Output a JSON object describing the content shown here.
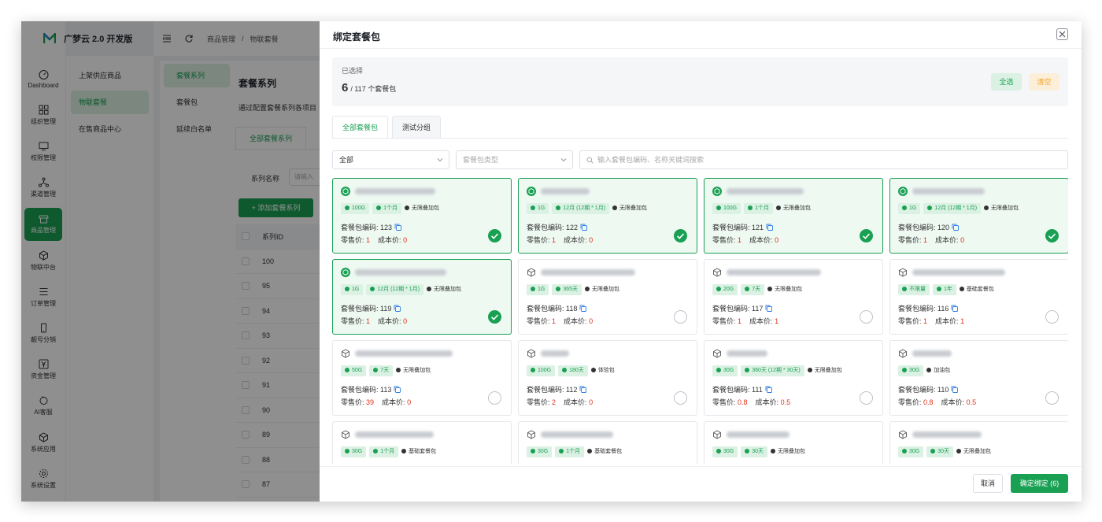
{
  "app": {
    "title": "广梦云 2.0 开发版"
  },
  "nav": [
    {
      "label": "Dashboard",
      "icon": "dashboard-icon",
      "active": false
    },
    {
      "label": "组织管理",
      "icon": "grid-icon",
      "active": false
    },
    {
      "label": "权限管理",
      "icon": "monitor-icon",
      "active": false
    },
    {
      "label": "渠道管理",
      "icon": "network-icon",
      "active": false
    },
    {
      "label": "商品管理",
      "icon": "store-icon",
      "active": true
    },
    {
      "label": "物联中台",
      "icon": "cube-icon",
      "active": false
    },
    {
      "label": "订单管理",
      "icon": "list-icon",
      "active": false
    },
    {
      "label": "靓号分销",
      "icon": "phone-icon",
      "active": false
    },
    {
      "label": "资金管理",
      "icon": "yuan-icon",
      "active": false
    },
    {
      "label": "AI客服",
      "icon": "bot-icon",
      "active": false
    },
    {
      "label": "系统应用",
      "icon": "box-icon",
      "active": false
    },
    {
      "label": "系统设置",
      "icon": "gear-icon",
      "active": false
    }
  ],
  "subnav": [
    {
      "label": "上架供应商品",
      "active": false
    },
    {
      "label": "物联套餐",
      "active": true
    },
    {
      "label": "在售商品中心",
      "active": false
    }
  ],
  "breadcrumb": {
    "parent": "商品管理",
    "sep": "/",
    "current": "物联套餐"
  },
  "series_menu": [
    {
      "label": "套餐系列",
      "active": true
    },
    {
      "label": "套餐包",
      "active": false
    },
    {
      "label": "延续白名单",
      "active": false
    }
  ],
  "content": {
    "title": "套餐系列",
    "desc": "通过配置套餐系列各项目",
    "tab": "全部套餐系列",
    "filter_label": "系列名称",
    "filter_placeholder": "请输入",
    "add_button": "+ 添加套餐系列",
    "col_id": "系列ID",
    "rows": [
      "100",
      "95",
      "94",
      "93",
      "92",
      "91",
      "90",
      "89",
      "88",
      "87"
    ]
  },
  "drawer": {
    "title": "绑定套餐包",
    "selected_label": "已选择",
    "selected_count": "6",
    "selected_total": "/ 117 个套餐包",
    "select_all": "全选",
    "clear": "清空",
    "tabs": [
      "全部套餐包",
      "测试分组"
    ],
    "filter_all": "全部",
    "filter_type_placeholder": "套餐包类型",
    "search_placeholder": "输入套餐包编码、名称关键词搜索",
    "cancel": "取消",
    "confirm": "确定绑定 (6)",
    "code_label": "套餐包编码:",
    "retail_label": "零售价:",
    "cost_label": "成本价:"
  },
  "cards": [
    {
      "data": "100G",
      "period": "1个月",
      "kind": "无限叠加包",
      "code": "123",
      "retail": "1",
      "cost": "0",
      "selected": true
    },
    {
      "data": "1G",
      "period": "12月 (12期 * 1月)",
      "kind": "无限叠加包",
      "code": "122",
      "retail": "1",
      "cost": "0",
      "selected": true
    },
    {
      "data": "100G",
      "period": "1个月",
      "kind": "无限叠加包",
      "code": "121",
      "retail": "1",
      "cost": "0",
      "selected": true
    },
    {
      "data": "1G",
      "period": "12月 (12期 * 1月)",
      "kind": "无限叠加包",
      "code": "120",
      "retail": "1",
      "cost": "0",
      "selected": true
    },
    {
      "data": "1G",
      "period": "12月 (12期 * 1月)",
      "kind": "无限叠加包",
      "code": "119",
      "retail": "1",
      "cost": "0",
      "selected": true
    },
    {
      "data": "1G",
      "period": "365天",
      "kind": "无限叠加包",
      "code": "118",
      "retail": "1",
      "cost": "0",
      "selected": false
    },
    {
      "data": "20G",
      "period": "7天",
      "kind": "无限叠加包",
      "code": "117",
      "retail": "1",
      "cost": "1",
      "selected": false
    },
    {
      "data": "不限量",
      "period": "1年",
      "kind": "基础套餐包",
      "code": "116",
      "retail": "1",
      "cost": "1",
      "selected": false
    },
    {
      "data": "50G",
      "period": "7天",
      "kind": "无限叠加包",
      "code": "113",
      "retail": "39",
      "cost": "0",
      "selected": false
    },
    {
      "data": "100G",
      "period": "180天",
      "kind": "体验包",
      "code": "112",
      "retail": "2",
      "cost": "0",
      "selected": false
    },
    {
      "data": "30G",
      "period": "360天 (12期 * 30天)",
      "kind": "无限叠加包",
      "code": "111",
      "retail": "0.8",
      "cost": "0.5",
      "selected": false
    },
    {
      "data": "30G",
      "period": "",
      "kind": "加油包",
      "code": "110",
      "retail": "0.8",
      "cost": "0.5",
      "selected": false
    },
    {
      "data": "30G",
      "period": "1个月",
      "kind": "基础套餐包",
      "code": "",
      "retail": "",
      "cost": "",
      "selected": false
    },
    {
      "data": "30G",
      "period": "1个月",
      "kind": "基础套餐包",
      "code": "",
      "retail": "",
      "cost": "",
      "selected": false
    },
    {
      "data": "30G",
      "period": "30天",
      "kind": "无限叠加包",
      "code": "",
      "retail": "",
      "cost": "",
      "selected": false
    },
    {
      "data": "30G",
      "period": "30天",
      "kind": "无限叠加包",
      "code": "",
      "retail": "",
      "cost": "",
      "selected": false
    }
  ],
  "colors": {
    "accent": "#1aa053",
    "danger": "#e0321d",
    "warning": "#f0a020"
  }
}
